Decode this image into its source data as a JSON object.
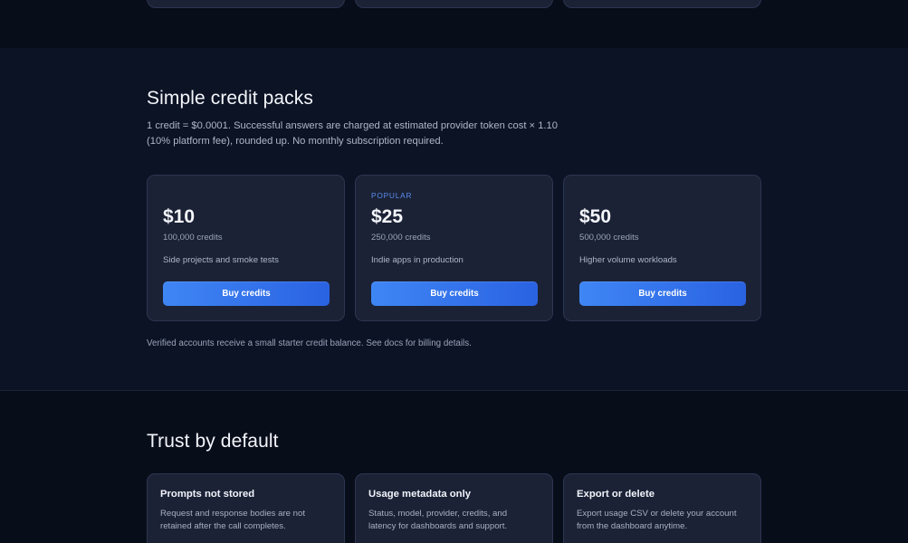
{
  "pricing": {
    "title": "Simple credit packs",
    "lead_line1": "1 credit = $0.0001. Successful answers are charged at estimated provider token cost × 1.10",
    "lead_line2": "(10% platform fee), rounded up. No monthly subscription required.",
    "packs": [
      {
        "tag": "",
        "price": "$10",
        "credits": "100,000 credits",
        "description": "Side projects and smoke tests",
        "button": "Buy credits"
      },
      {
        "tag": "POPULAR",
        "price": "$25",
        "credits": "250,000 credits",
        "description": "Indie apps in production",
        "button": "Buy credits"
      },
      {
        "tag": "",
        "price": "$50",
        "credits": "500,000 credits",
        "description": "Higher volume workloads",
        "button": "Buy credits"
      }
    ],
    "note": "Verified accounts receive a small starter credit balance. See docs for billing details."
  },
  "trust": {
    "title": "Trust by default",
    "cards": [
      {
        "title": "Prompts not stored",
        "line1": "Request and response bodies are not",
        "line2": "retained after the call completes."
      },
      {
        "title": "Usage metadata only",
        "line1": "Status, model, provider, credits, and",
        "line2": "latency for dashboards and support."
      },
      {
        "title": "Export or delete",
        "line1": "Export usage CSV or delete your account",
        "line2": "from the dashboard anytime."
      }
    ]
  },
  "colors": {
    "accent": "#3f86f5",
    "background": "#0b1120",
    "card": "#1b2236",
    "popular_tag": "#5b8def"
  }
}
